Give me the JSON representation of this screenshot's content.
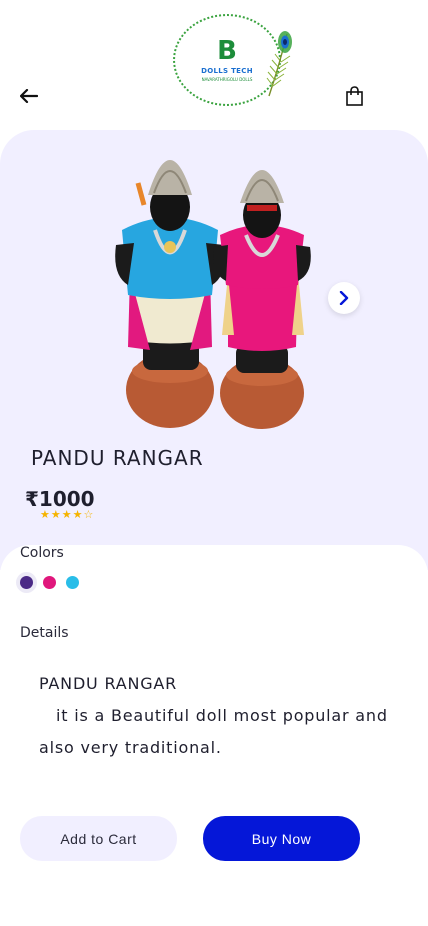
{
  "header": {
    "brand_name": "DOLLS TECH",
    "brand_tagline": "NAVARATHRIGOLU DOLLS",
    "back_icon": "arrow-left-icon",
    "cart_icon": "shopping-bag-icon"
  },
  "product": {
    "title": "PANDU RANGAR",
    "price": "₹1000",
    "rating": 4,
    "rating_max": 5,
    "next_icon": "chevron-right-icon"
  },
  "colors": {
    "label": "Colors",
    "options": [
      "#4b2a86",
      "#e0177c",
      "#29bde8"
    ],
    "selected_index": 0
  },
  "details": {
    "label": "Details",
    "title": "PANDU RANGAR",
    "body": "it is a Beautiful doll most popular and also very traditional."
  },
  "actions": {
    "add_to_cart": "Add to Cart",
    "buy_now": "Buy Now"
  },
  "theme": {
    "accent": "#0517d8",
    "panel": "#f1efff",
    "star": "#f5b300"
  }
}
